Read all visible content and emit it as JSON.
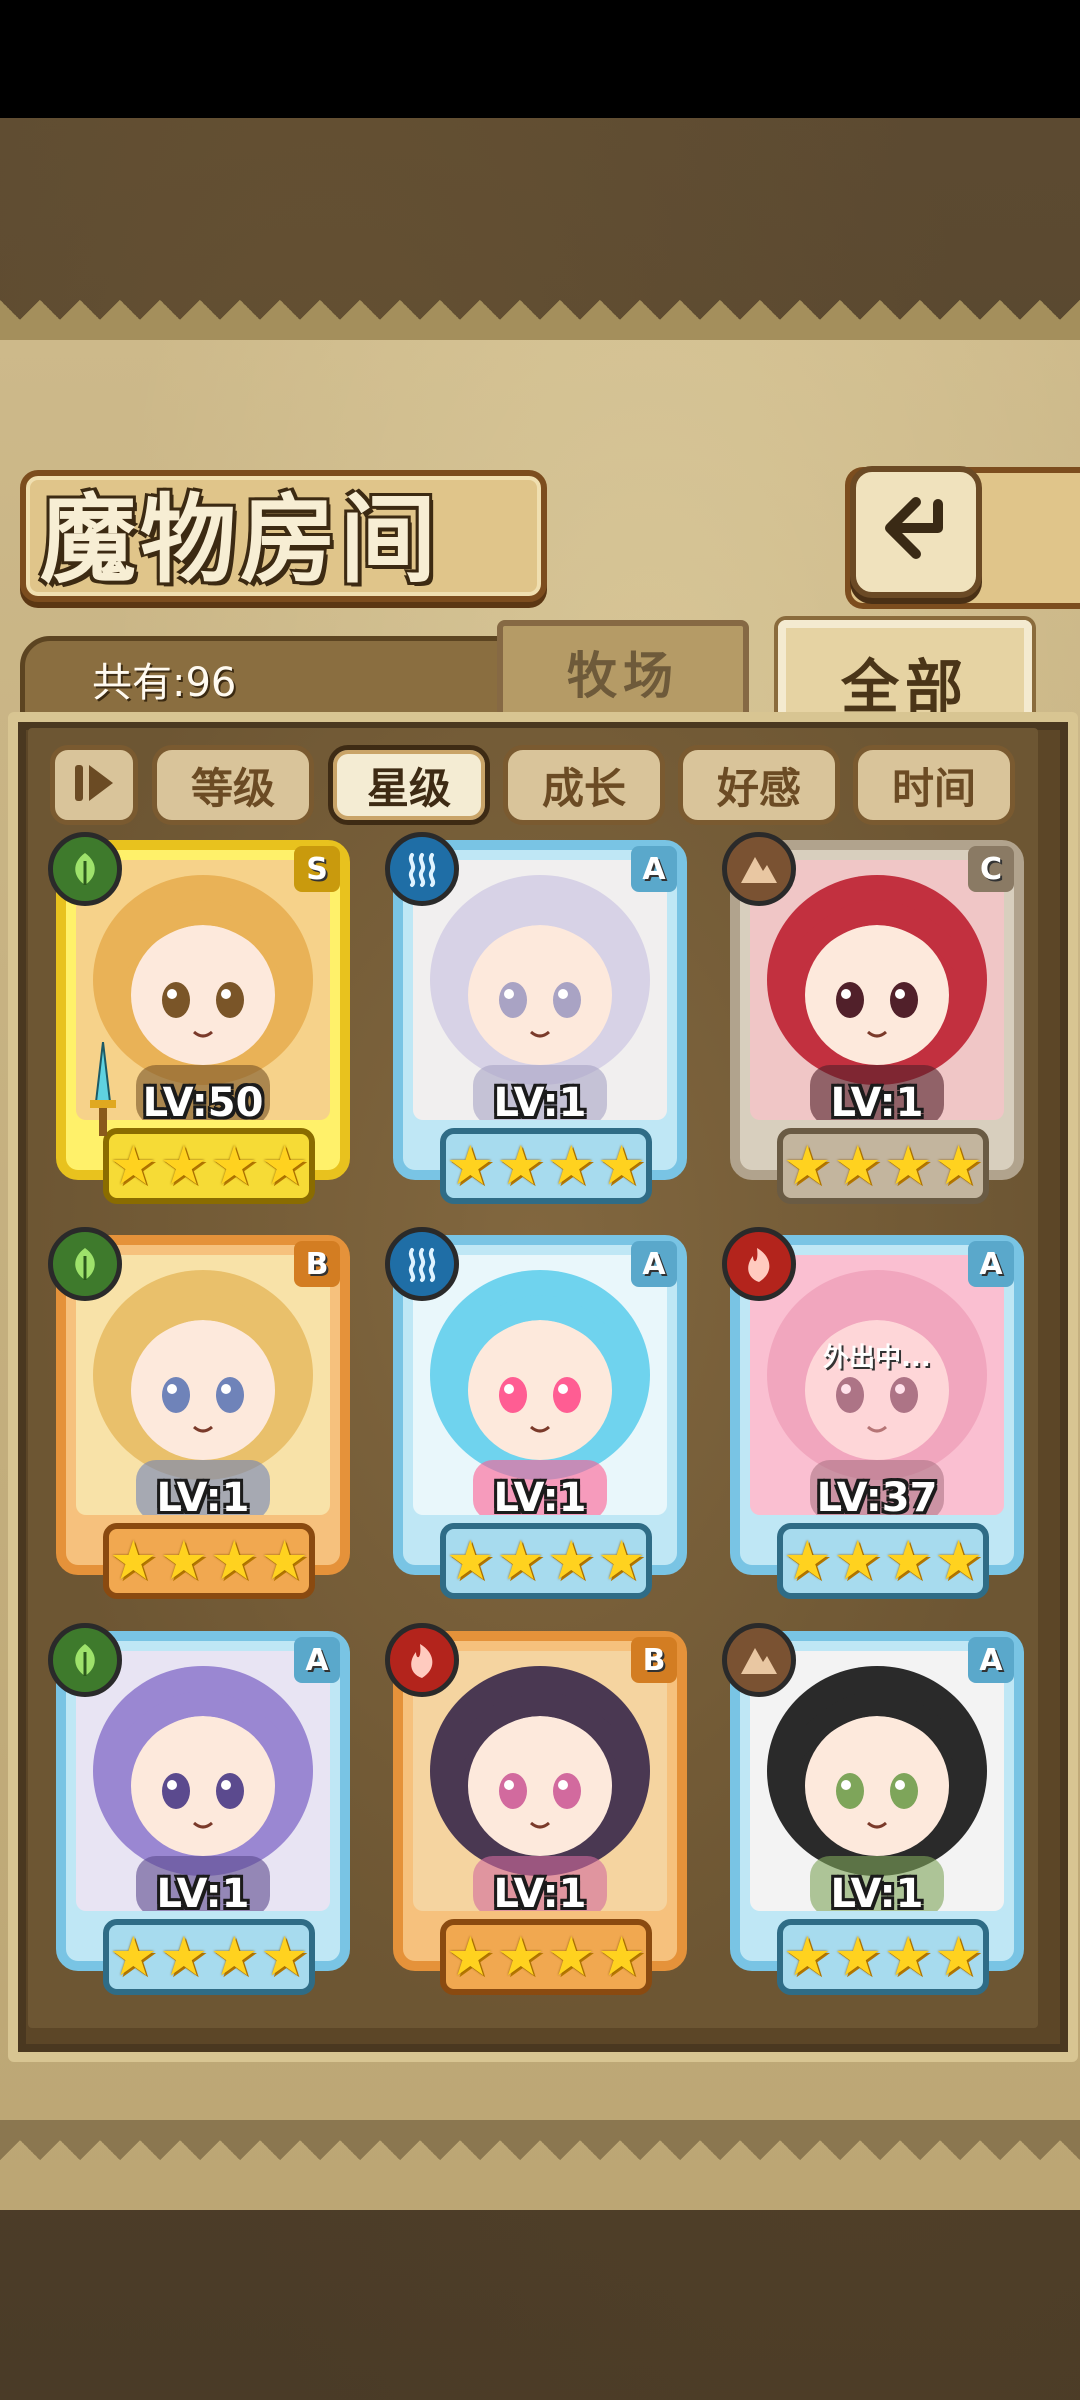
{
  "header": {
    "title": "魔物房间",
    "count_label": "共有:96"
  },
  "tabs": {
    "ranch": "牧场",
    "all": "全部"
  },
  "filters": [
    {
      "label": "等级",
      "active": false
    },
    {
      "label": "星级",
      "active": true
    },
    {
      "label": "成长",
      "active": false
    },
    {
      "label": "好感",
      "active": false
    },
    {
      "label": "时间",
      "active": false
    }
  ],
  "cards": [
    {
      "level": "LV:50",
      "rank": "S",
      "element": "grass-icon",
      "rarity": "gold",
      "stars": 4,
      "status": ""
    },
    {
      "level": "LV:1",
      "rank": "A",
      "element": "water-icon",
      "rarity": "blue",
      "stars": 4,
      "status": ""
    },
    {
      "level": "LV:1",
      "rank": "C",
      "element": "earth-icon",
      "rarity": "gray",
      "stars": 4,
      "status": ""
    },
    {
      "level": "LV:1",
      "rank": "B",
      "element": "grass-icon",
      "rarity": "orange",
      "stars": 4,
      "status": ""
    },
    {
      "level": "LV:1",
      "rank": "A",
      "element": "water-icon",
      "rarity": "blue",
      "stars": 4,
      "status": ""
    },
    {
      "level": "LV:37",
      "rank": "A",
      "element": "fire-icon",
      "rarity": "blue",
      "stars": 4,
      "status": "外出中..."
    },
    {
      "level": "LV:1",
      "rank": "A",
      "element": "grass-icon",
      "rarity": "blue",
      "stars": 4,
      "status": ""
    },
    {
      "level": "LV:1",
      "rank": "B",
      "element": "fire-icon",
      "rarity": "orange",
      "stars": 4,
      "status": ""
    },
    {
      "level": "LV:1",
      "rank": "A",
      "element": "earth-icon",
      "rarity": "blue",
      "stars": 4,
      "status": ""
    }
  ],
  "colors": {
    "panel": "#c8b384",
    "frame": "#5c4627",
    "text_light": "#fffaf0"
  }
}
